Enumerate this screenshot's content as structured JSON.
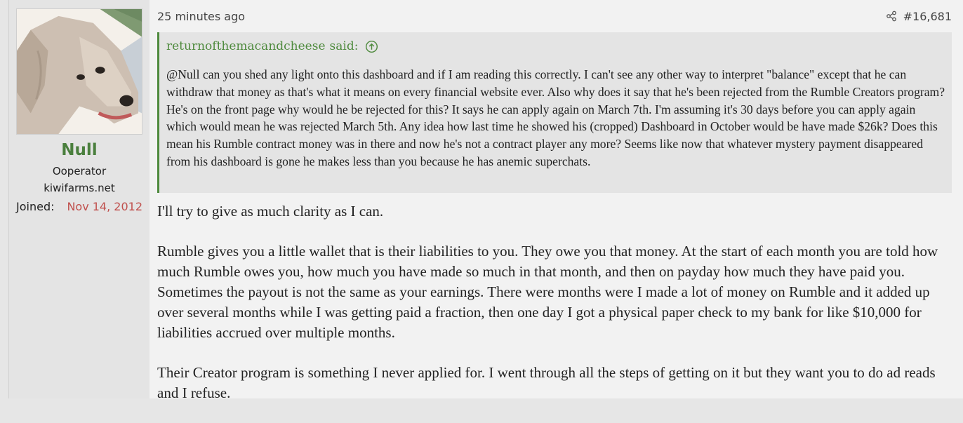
{
  "user": {
    "avatar_icon": "dog-avatar-icon",
    "name": "Null",
    "title": "Ooperator",
    "banner": "kiwifarms.net",
    "joined_label": "Joined:",
    "joined_date": "Nov 14, 2012"
  },
  "post": {
    "timestamp": "25 minutes ago",
    "share_icon": "share-icon",
    "number": "#16,681",
    "quote": {
      "author": "returnofthemacandcheese",
      "said": "said:",
      "jump_icon": "arrow-up-circle-icon",
      "text": "@Null can you shed any light onto this dashboard and if I am reading this correctly. I can't see any other way to interpret \"balance\" except that he can withdraw that money as that's what it means on every financial website ever. Also why does it say that he's been rejected from the Rumble Creators program? He's on the front page why would he be rejected for this? It says he can apply again on March 7th. I'm assuming it's 30 days before you can apply again which would mean he was rejected March 5th. Any idea how last time he showed his (cropped) Dashboard in October would be have made $26k? Does this mean his Rumble contract money was in there and now he's not a contract player any more? Seems like now that whatever mystery payment disappeared from his dashboard is gone he makes less than you because he has anemic superchats."
    },
    "paragraphs": [
      "I'll try to give as much clarity as I can.",
      "Rumble gives you a little wallet that is their liabilities to you. They owe you that money. At the start of each month you are told how much Rumble owes you, how much you have made so much in that month, and then on payday how much they have paid you. Sometimes the payout is not the same as your earnings. There were months were I made a lot of money on Rumble and it added up over several months while I was getting paid a fraction, then one day I got a physical paper check to my bank for like $10,000 for liabilities accrued over multiple months.",
      "Their Creator program is something I never applied for. I went through all the steps of getting on it but they want you to do ad reads and I refuse."
    ]
  },
  "colors": {
    "username": "#4a7f3d",
    "quote_accent": "#4e8a3d",
    "joined_date": "#c0504d"
  }
}
